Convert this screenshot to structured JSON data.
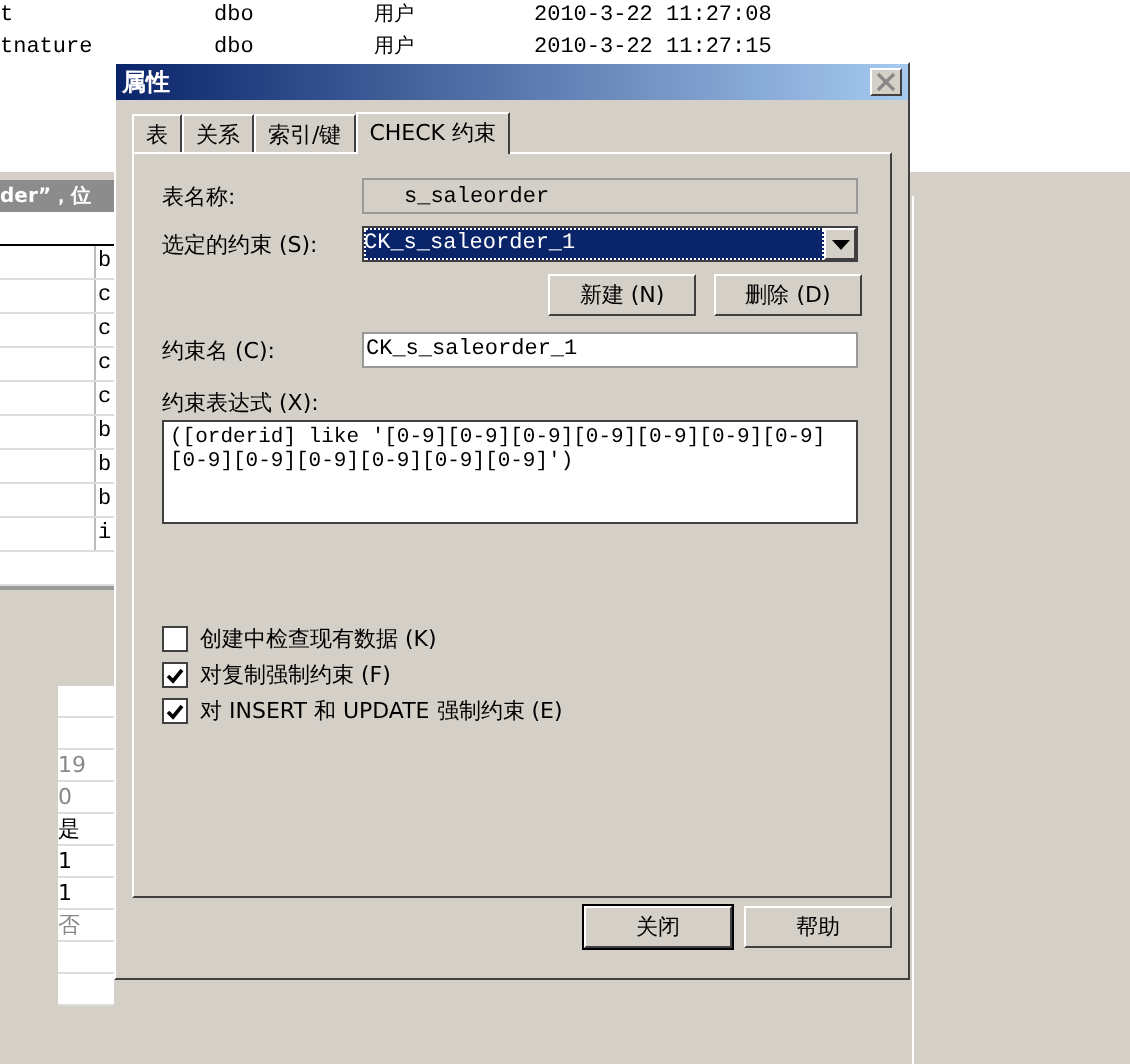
{
  "background": {
    "objects": [
      {
        "name": "t",
        "owner": "dbo",
        "type": "用户",
        "created": "2010-3-22 11:27:08"
      },
      {
        "name": "tnature",
        "owner": "dbo",
        "type": "用户",
        "created": "2010-3-22 11:27:15"
      }
    ],
    "header_strip": "der”，位",
    "grid_cells": [
      "b",
      "c",
      "c",
      "c",
      "c",
      "b",
      "b",
      "b",
      "i"
    ],
    "property_values": [
      {
        "text": "19",
        "disabled": true
      },
      {
        "text": "0",
        "disabled": true
      },
      {
        "text": "是",
        "disabled": false
      },
      {
        "text": "1",
        "disabled": false
      },
      {
        "text": "1",
        "disabled": false
      },
      {
        "text": "否",
        "disabled": true
      }
    ]
  },
  "window": {
    "title": "属性"
  },
  "tabs": [
    {
      "label": "表",
      "selected": false
    },
    {
      "label": "关系",
      "selected": false
    },
    {
      "label": "索引/键",
      "selected": false
    },
    {
      "label": "CHECK 约束",
      "selected": true
    }
  ],
  "table_name": {
    "label": "表名称:",
    "value": "s_saleorder"
  },
  "selected_constraint": {
    "label": "选定的约束 (S):",
    "value": "CK_s_saleorder_1"
  },
  "constraint_buttons": [
    "新建 (N)",
    "删除 (D)"
  ],
  "constraint_name": {
    "label": "约束名 (C):",
    "value": "CK_s_saleorder_1"
  },
  "constraint_expression": {
    "label": "约束表达式 (X):",
    "value": "([orderid] like '[0-9][0-9][0-9][0-9][0-9][0-9][0-9][0-9][0-9][0-9][0-9][0-9][0-9]')"
  },
  "options": [
    {
      "label": "创建中检查现有数据 (K)",
      "checked": false
    },
    {
      "label": "对复制强制约束 (F)",
      "checked": true
    },
    {
      "label": "对 INSERT 和 UPDATE 强制约束 (E)",
      "checked": true
    }
  ],
  "footer_buttons": [
    "关闭",
    "帮助"
  ]
}
